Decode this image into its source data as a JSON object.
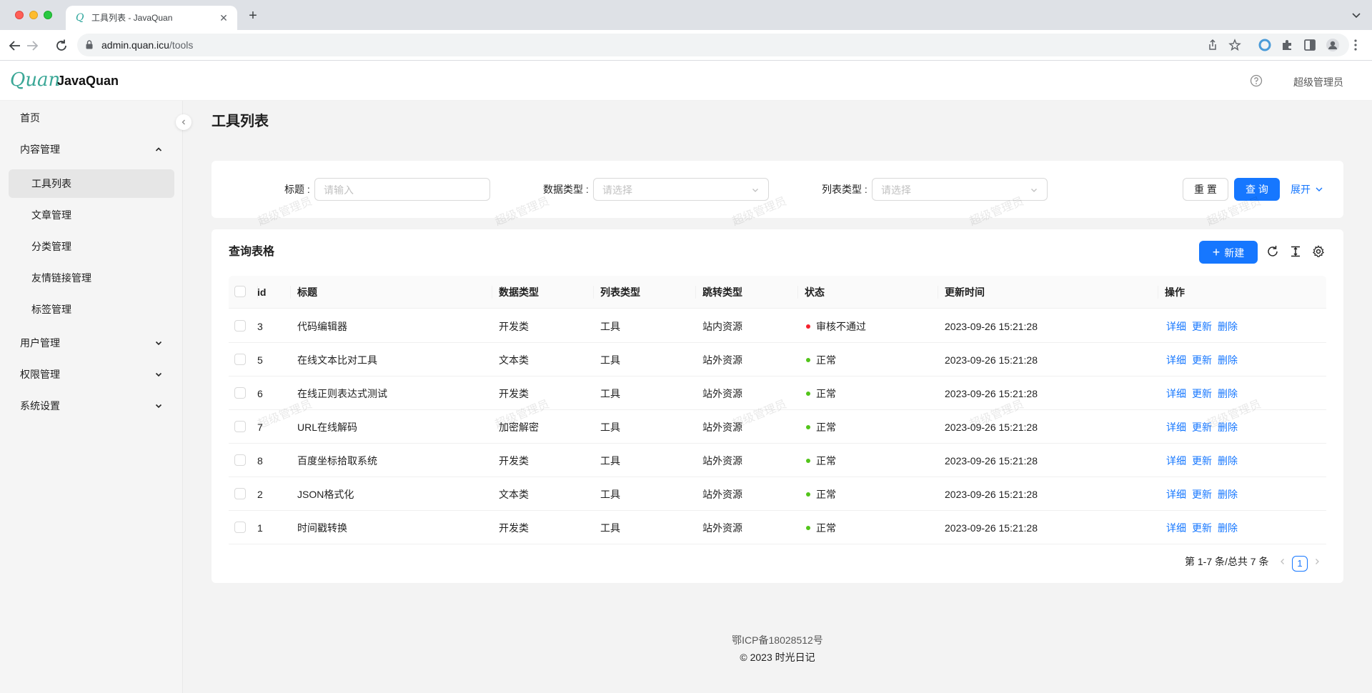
{
  "browser": {
    "tab_title": "工具列表 - JavaQuan",
    "url_host": "admin.quan.icu",
    "url_path": "/tools"
  },
  "header": {
    "logo_mark": "Quan",
    "logo_text": "JavaQuan",
    "user_name": "超级管理员"
  },
  "sidebar": {
    "items": [
      {
        "label": "首页"
      },
      {
        "label": "内容管理"
      },
      {
        "label": "工具列表"
      },
      {
        "label": "文章管理"
      },
      {
        "label": "分类管理"
      },
      {
        "label": "友情链接管理"
      },
      {
        "label": "标签管理"
      },
      {
        "label": "用户管理"
      },
      {
        "label": "权限管理"
      },
      {
        "label": "系统设置"
      }
    ]
  },
  "page": {
    "title": "工具列表"
  },
  "search": {
    "title_label": "标题 :",
    "title_placeholder": "请输入",
    "data_type_label": "数据类型 :",
    "data_type_placeholder": "请选择",
    "list_type_label": "列表类型 :",
    "list_type_placeholder": "请选择",
    "reset_label": "重 置",
    "query_label": "查 询",
    "expand_label": "展开"
  },
  "table": {
    "title": "查询表格",
    "new_label": "新建",
    "columns": [
      "id",
      "标题",
      "数据类型",
      "列表类型",
      "跳转类型",
      "状态",
      "更新时间",
      "操作"
    ],
    "rows": [
      {
        "id": "3",
        "title": "代码编辑器",
        "data_type": "开发类",
        "list_type": "工具",
        "jump_type": "站内资源",
        "status": "审核不通过",
        "status_color": "#f5222d",
        "updated": "2023-09-26 15:21:28"
      },
      {
        "id": "5",
        "title": "在线文本比对工具",
        "data_type": "文本类",
        "list_type": "工具",
        "jump_type": "站外资源",
        "status": "正常",
        "status_color": "#52c41a",
        "updated": "2023-09-26 15:21:28"
      },
      {
        "id": "6",
        "title": "在线正则表达式测试",
        "data_type": "开发类",
        "list_type": "工具",
        "jump_type": "站外资源",
        "status": "正常",
        "status_color": "#52c41a",
        "updated": "2023-09-26 15:21:28"
      },
      {
        "id": "7",
        "title": "URL在线解码",
        "data_type": "加密解密",
        "list_type": "工具",
        "jump_type": "站外资源",
        "status": "正常",
        "status_color": "#52c41a",
        "updated": "2023-09-26 15:21:28"
      },
      {
        "id": "8",
        "title": "百度坐标拾取系统",
        "data_type": "开发类",
        "list_type": "工具",
        "jump_type": "站外资源",
        "status": "正常",
        "status_color": "#52c41a",
        "updated": "2023-09-26 15:21:28"
      },
      {
        "id": "2",
        "title": "JSON格式化",
        "data_type": "文本类",
        "list_type": "工具",
        "jump_type": "站外资源",
        "status": "正常",
        "status_color": "#52c41a",
        "updated": "2023-09-26 15:21:28"
      },
      {
        "id": "1",
        "title": "时间戳转换",
        "data_type": "开发类",
        "list_type": "工具",
        "jump_type": "站外资源",
        "status": "正常",
        "status_color": "#52c41a",
        "updated": "2023-09-26 15:21:28"
      }
    ],
    "actions": {
      "detail": "详细",
      "update": "更新",
      "delete": "删除"
    }
  },
  "pagination": {
    "total_text": "第 1-7 条/总共 7 条",
    "current_page": "1"
  },
  "footer": {
    "icp": "鄂ICP备18028512号",
    "copyright": "© 2023 时光日记"
  },
  "watermark": "超级管理员",
  "colors": {
    "primary": "#1677ff",
    "brand_teal": "#3aa796",
    "status_error": "#f5222d",
    "status_success": "#52c41a"
  }
}
